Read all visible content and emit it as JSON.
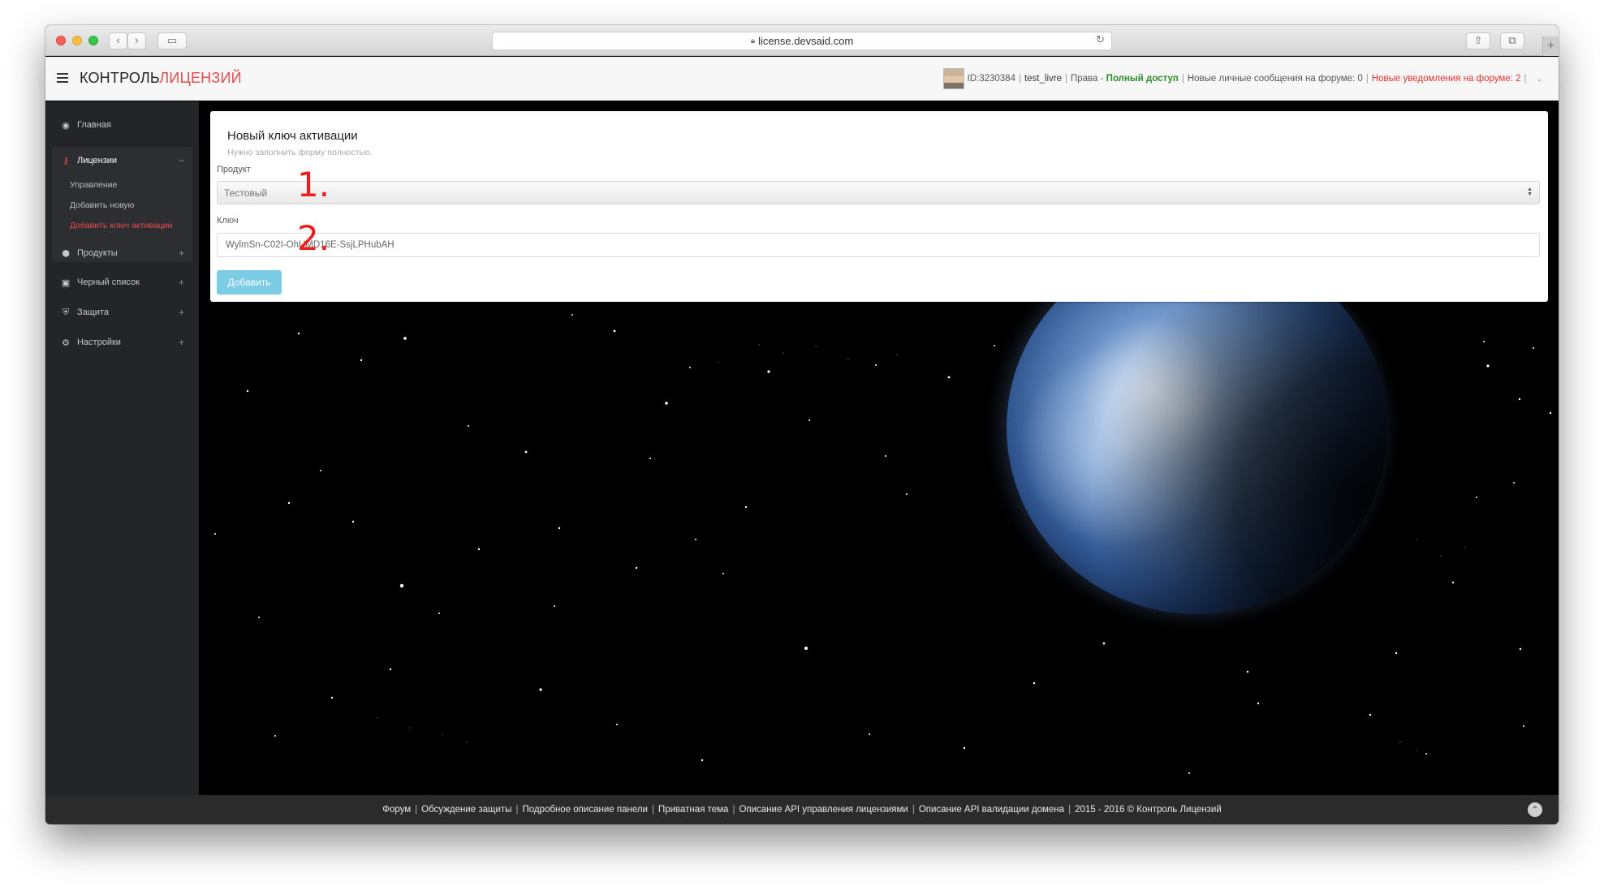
{
  "browser": {
    "url": "license.devsaid.com",
    "buttons": {
      "back": "‹",
      "forward": "›",
      "sidebar": "▭",
      "share": "⇧",
      "tabs": "⧉",
      "reload": "↻",
      "new_tab": "+"
    },
    "icons": [
      "close-icon",
      "minimize-icon",
      "zoom-icon",
      "lock-icon",
      "reload-icon",
      "share-icon",
      "tabs-icon"
    ]
  },
  "header": {
    "brand_part1": "КОНТРОЛЬ",
    "brand_part2": "ЛИЦЕНЗИЙ",
    "user_id": "ID:3230384",
    "username": "test_livre",
    "rights_label": "Права - ",
    "rights_value": "Полный доступ",
    "messages": "Новые личные сообщения на форуме: 0",
    "notifications": "Новые уведомления на форуме: 2",
    "separator": "|",
    "caret": "⌄"
  },
  "sidebar": {
    "items": [
      {
        "label": "Главная",
        "icon": "dashboard-icon",
        "glyph": "◉"
      },
      {
        "label": "Лицензии",
        "icon": "key-icon",
        "glyph": "⚷",
        "toggle": "−"
      },
      {
        "label": "Продукты",
        "icon": "tags-icon",
        "glyph": "⬢",
        "toggle": "+"
      },
      {
        "label": "Черный список",
        "icon": "lock-icon",
        "glyph": "▣",
        "toggle": "+"
      },
      {
        "label": "Защита",
        "icon": "shield-icon",
        "glyph": "⛨",
        "toggle": "+"
      },
      {
        "label": "Настройки",
        "icon": "cogs-icon",
        "glyph": "⚙",
        "toggle": "+"
      }
    ],
    "submenu": [
      "Управление",
      "Добавить новую",
      "Добавить ключ активации"
    ]
  },
  "form": {
    "title": "Новый ключ активации",
    "subtitle": "Нужно заполнить форму полностью.",
    "product_label": "Продукт",
    "product_value": "Тестовый",
    "key_label": "Ключ",
    "key_value": "WylmSn-C02I-OhUMD16E-SsjLPHubAH",
    "submit": "Добавить",
    "annotation_1": "1.",
    "annotation_2": "2."
  },
  "footer": {
    "links": [
      "Форум",
      "Обсуждение защиты",
      "Подробное описание панели",
      "Приватная тема",
      "Описание API управления лицензиями",
      "Описание API валидации домена",
      "2015 - 2016 © Контроль Лицензий"
    ],
    "separator": "|",
    "scroll_top": "⌃"
  },
  "colors": {
    "accent": "#e64b4b",
    "button": "#5bc0de",
    "success": "#2d8a2d",
    "sidebar": "#232527"
  }
}
